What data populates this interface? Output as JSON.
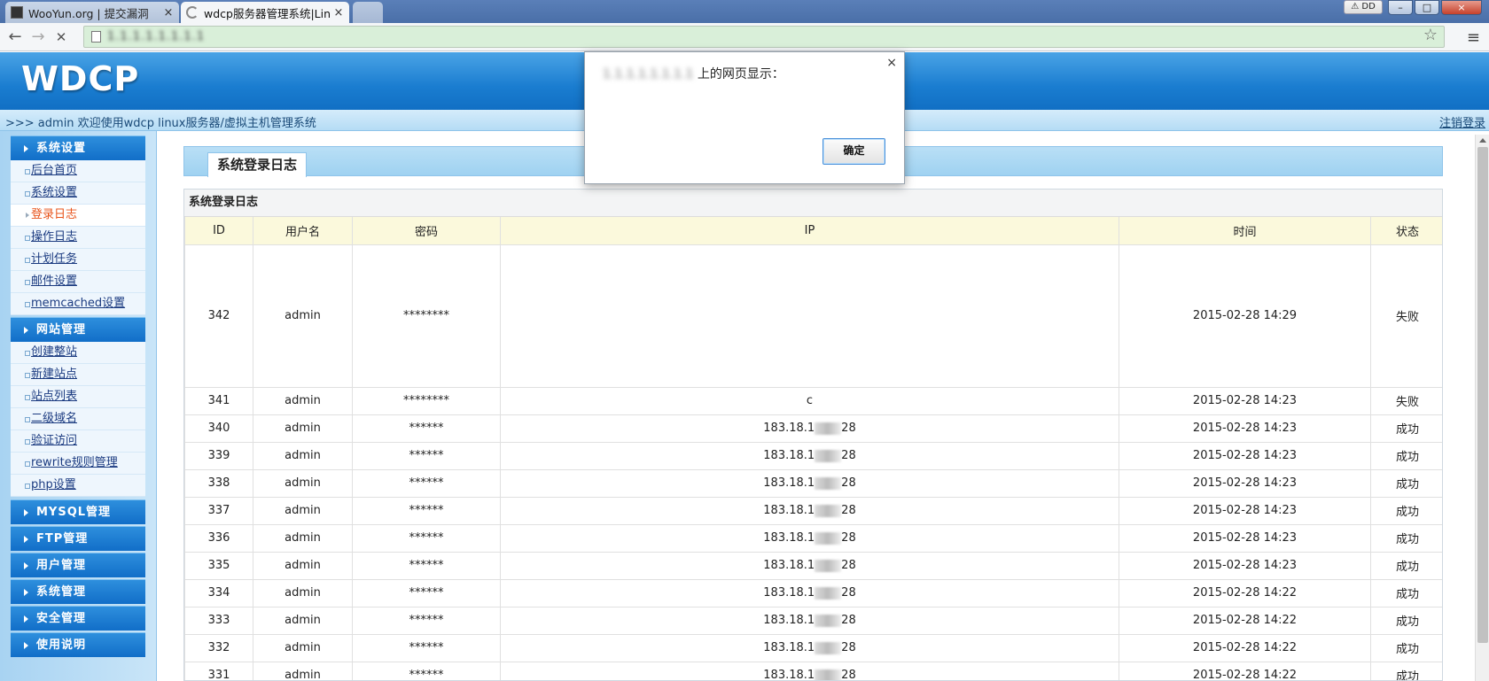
{
  "browser": {
    "tabs": [
      {
        "title": "WooYun.org | 提交漏洞",
        "close": "×"
      },
      {
        "title": "wdcp服务器管理系统|Lin",
        "close": "×"
      }
    ],
    "user_badge": "DD",
    "url": "1.1.1.1.1.1.1.1",
    "window_buttons": {
      "minimize": "–",
      "maximize": "□",
      "close": "×"
    },
    "icons": {
      "back": "←",
      "forward": "→",
      "stop": "✕",
      "star": "☆",
      "menu": "≡"
    }
  },
  "header": {
    "logo": "WDCP",
    "welcome": ">>> admin 欢迎使用wdcp linux服务器/虚拟主机管理系统",
    "logout": "注销登录"
  },
  "sidebar": {
    "sections": [
      {
        "title": "系统设置",
        "items": [
          "后台首页",
          "系统设置",
          "登录日志",
          "操作日志",
          "计划任务",
          "邮件设置",
          "memcached设置"
        ],
        "active": "登录日志"
      },
      {
        "title": "网站管理",
        "items": [
          "创建整站",
          "新建站点",
          "站点列表",
          "二级域名",
          "验证访问",
          "rewrite规则管理",
          "php设置"
        ]
      },
      {
        "title": "MYSQL管理"
      },
      {
        "title": "FTP管理"
      },
      {
        "title": "用户管理"
      },
      {
        "title": "系统管理"
      },
      {
        "title": "安全管理"
      },
      {
        "title": "使用说明"
      }
    ]
  },
  "page": {
    "tab_title": "系统登录日志",
    "panel_title": "系统登录日志",
    "columns": [
      "ID",
      "用户名",
      "密码",
      "IP",
      "时间",
      "状态"
    ],
    "rows": [
      {
        "id": "342",
        "user": "admin",
        "password": "********",
        "ip": "",
        "time": "2015-02-28 14:29",
        "status": "失败"
      },
      {
        "id": "341",
        "user": "admin",
        "password": "********",
        "ip": "c",
        "time": "2015-02-28 14:23",
        "status": "失败"
      },
      {
        "id": "340",
        "user": "admin",
        "password": "******",
        "ip": "183.18.1 28",
        "time": "2015-02-28 14:23",
        "status": "成功"
      },
      {
        "id": "339",
        "user": "admin",
        "password": "******",
        "ip": "183.18.1 28",
        "time": "2015-02-28 14:23",
        "status": "成功"
      },
      {
        "id": "338",
        "user": "admin",
        "password": "******",
        "ip": "183.18.1 28",
        "time": "2015-02-28 14:23",
        "status": "成功"
      },
      {
        "id": "337",
        "user": "admin",
        "password": "******",
        "ip": "183.18.1 28",
        "time": "2015-02-28 14:23",
        "status": "成功"
      },
      {
        "id": "336",
        "user": "admin",
        "password": "******",
        "ip": "183.18.1 28",
        "time": "2015-02-28 14:23",
        "status": "成功"
      },
      {
        "id": "335",
        "user": "admin",
        "password": "******",
        "ip": "183.18.1 28",
        "time": "2015-02-28 14:23",
        "status": "成功"
      },
      {
        "id": "334",
        "user": "admin",
        "password": "******",
        "ip": "183.18.1 28",
        "time": "2015-02-28 14:22",
        "status": "成功"
      },
      {
        "id": "333",
        "user": "admin",
        "password": "******",
        "ip": "183.18.1 28",
        "time": "2015-02-28 14:22",
        "status": "成功"
      },
      {
        "id": "332",
        "user": "admin",
        "password": "******",
        "ip": "183.18.1 28",
        "time": "2015-02-28 14:22",
        "status": "成功"
      },
      {
        "id": "331",
        "user": "admin",
        "password": "******",
        "ip": "183.18.1 28",
        "time": "2015-02-28 14:22",
        "status": "成功"
      }
    ]
  },
  "dialog": {
    "host": "1.1.1.1.1.1.1.1",
    "message": " 上的网页显示：",
    "ok": "确定",
    "close": "×"
  }
}
